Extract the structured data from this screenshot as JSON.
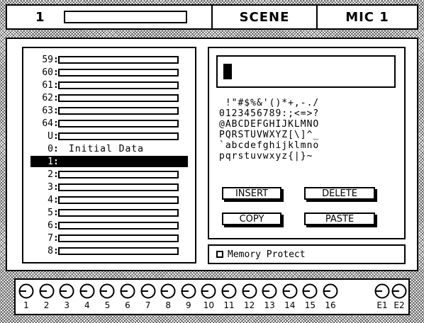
{
  "titlebar": {
    "scene_number": "1",
    "mode": "SCENE",
    "channel": "MIC 1"
  },
  "scene_list": {
    "rows": [
      {
        "num": "59",
        "title": ""
      },
      {
        "num": "60",
        "title": ""
      },
      {
        "num": "61",
        "title": ""
      },
      {
        "num": "62",
        "title": ""
      },
      {
        "num": "63",
        "title": ""
      },
      {
        "num": "64",
        "title": ""
      },
      {
        "num": "U",
        "title": ""
      },
      {
        "num": "0",
        "title": "Initial Data"
      },
      {
        "num": "1",
        "title": "",
        "selected": true
      },
      {
        "num": "2",
        "title": ""
      },
      {
        "num": "3",
        "title": ""
      },
      {
        "num": "4",
        "title": ""
      },
      {
        "num": "5",
        "title": ""
      },
      {
        "num": "6",
        "title": ""
      },
      {
        "num": "7",
        "title": ""
      },
      {
        "num": "8",
        "title": ""
      }
    ]
  },
  "title_edit": {
    "name_value": "",
    "charset": [
      " !\"#$%&'()*+,-./",
      "0123456789:;<=>?",
      "@ABCDEFGHIJKLMNO",
      "PQRSTUVWXYZ[\\]^_",
      "`abcdefghijklmno",
      "pqrstuvwxyz{|}~"
    ],
    "insert_label": "INSERT",
    "delete_label": "DELETE",
    "copy_label": "COPY",
    "paste_label": "PASTE"
  },
  "memory_protect": {
    "label": "Memory Protect",
    "checked": false
  },
  "channels": [
    "1",
    "2",
    "3",
    "4",
    "5",
    "6",
    "7",
    "8",
    "9",
    "10",
    "11",
    "12",
    "13",
    "14",
    "15",
    "16",
    "E1",
    "E2"
  ]
}
